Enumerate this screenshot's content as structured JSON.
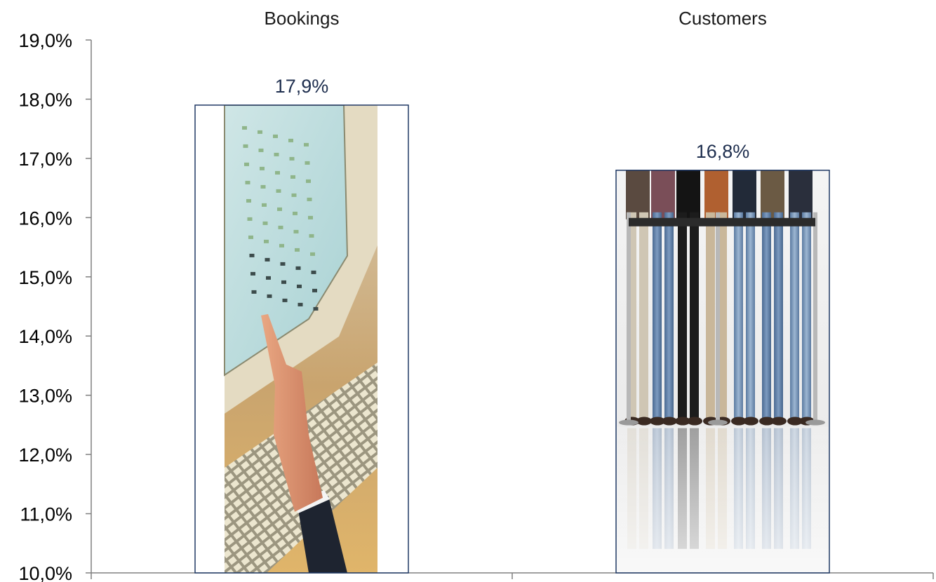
{
  "chart_data": {
    "type": "bar",
    "categories": [
      "Bookings",
      "Customers"
    ],
    "values": [
      17.9,
      16.8
    ],
    "data_labels": [
      "17,9%",
      "16,8%"
    ],
    "ylim": [
      10,
      19
    ],
    "yticks": [
      10,
      11,
      12,
      13,
      14,
      15,
      16,
      17,
      18,
      19
    ],
    "ytick_labels": [
      "10,0%",
      "11,0%",
      "12,0%",
      "13,0%",
      "14,0%",
      "15,0%",
      "16,0%",
      "17,0%",
      "18,0%",
      "19,0%"
    ],
    "category_label_position": "top",
    "grid": false,
    "legend": "none",
    "bar_fill": {
      "Bookings": "photo: hand pointing at computer monitor with keyboard",
      "Customers": "photo: row of people's legs in jeans behind a queue barrier"
    },
    "colors": {
      "bar_border": "#1f3864",
      "axis": "#808080",
      "label_text": "#1f2f4f"
    }
  }
}
